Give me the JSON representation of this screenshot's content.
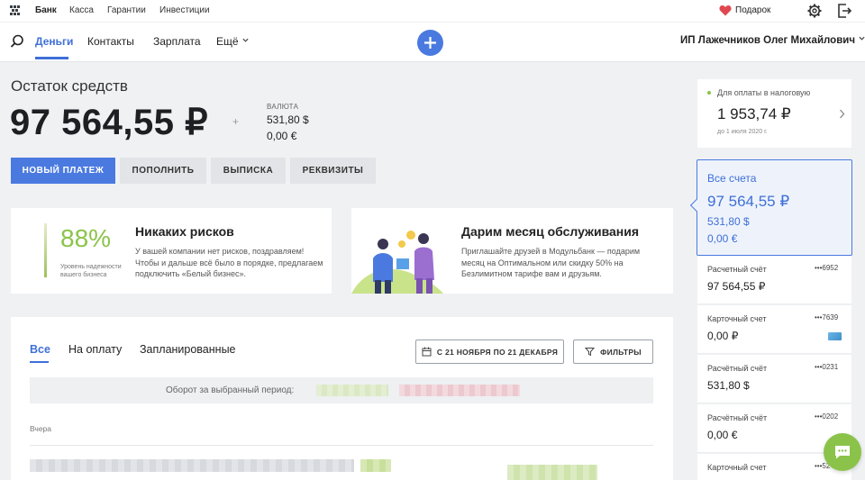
{
  "top_nav": {
    "links": [
      "Банк",
      "Касса",
      "Гарантии",
      "Инвестиции"
    ],
    "gift_label": "Подарок"
  },
  "main_nav": {
    "items": [
      "Деньги",
      "Контакты",
      "Зарплата",
      "Ещё"
    ],
    "active": "Деньги",
    "user_name": "ИП Лажечников Олег Михайлович"
  },
  "balance": {
    "label": "Остаток средств",
    "amount": "97 564,55 ₽",
    "plus_sign": "+",
    "currency_label": "ВАЛЮТА",
    "currency_values": [
      "531,80 $",
      "0,00 €"
    ]
  },
  "actions": {
    "new_payment": "НОВЫЙ ПЛАТЕЖ",
    "top_up": "ПОПОЛНИТЬ",
    "statement": "ВЫПИСКА",
    "details": "РЕКВИЗИТЫ"
  },
  "risk_card": {
    "percent": "88%",
    "percent_caption": "Уровень надежности вашего бизнеса",
    "title": "Никаких рисков",
    "text": "У вашей компании нет рисков, поздравляем! Чтобы и дальше всё было в порядке, предлагаем подключить «Белый бизнес»."
  },
  "promo_card": {
    "title": "Дарим месяц обслуживания",
    "text": "Приглашайте друзей в Модульбанк — подарим месяц на Оптимальном или скидку 50% на Безлимитном тарифе вам и друзьям."
  },
  "operations": {
    "tabs": [
      "Все",
      "На оплату",
      "Запланированные"
    ],
    "active_tab": "Все",
    "period_button": "С 21 НОЯБРЯ ПО 21 ДЕКАБРЯ",
    "filters_button": "ФИЛЬТРЫ",
    "turnover_label": "Оборот за выбранный период:",
    "day_label": "Вчера"
  },
  "tax": {
    "label": "Для оплаты в налоговую",
    "amount": "1 953,74 ₽",
    "date": "до 1 июля 2020 г."
  },
  "all_accounts": {
    "label": "Все счета",
    "amount": "97 564,55 ₽",
    "sub_amounts": [
      "531,80 $",
      "0,00 €"
    ]
  },
  "accounts": [
    {
      "name": "Расчетный счёт",
      "number": "•••6952",
      "balance": "97 564,55 ₽"
    },
    {
      "name": "Карточный счет",
      "number": "•••7639",
      "balance": "0,00 ₽"
    },
    {
      "name": "Расчётный счёт",
      "number": "•••0231",
      "balance": "531,80 $"
    },
    {
      "name": "Расчётный счёт",
      "number": "•••0202",
      "balance": "0,00 €"
    },
    {
      "name": "Карточный счет",
      "number": "•••52",
      "balance": ""
    }
  ],
  "colors": {
    "accent": "#4a7ae0",
    "green": "#8bc34a",
    "bg": "#f0f1f3"
  }
}
